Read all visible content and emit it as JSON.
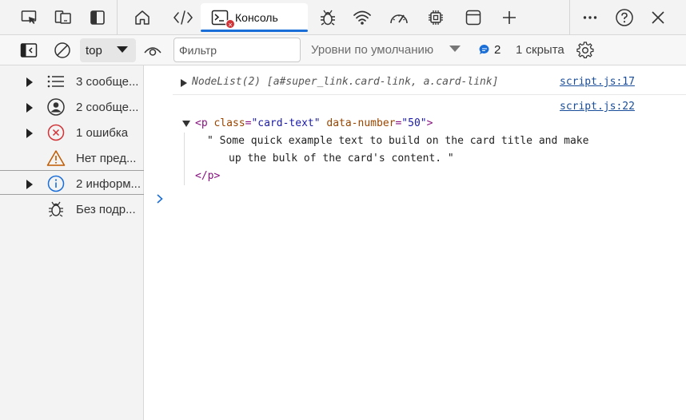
{
  "tabbar": {
    "console_tab_label": "Консоль",
    "console_error_badge": "×"
  },
  "toolbar": {
    "context": "top",
    "filter_placeholder": "Фильтр",
    "levels": "Уровни по умолчанию",
    "issues_count": "2",
    "hidden_label": "1 скрыта"
  },
  "sidebar": {
    "items": [
      {
        "label": "3 сообще...",
        "icon": "list-icon"
      },
      {
        "label": "2 сообще...",
        "icon": "user-icon"
      },
      {
        "label": "1 ошибка",
        "icon": "error-icon"
      },
      {
        "label": "Нет пред...",
        "icon": "warning-icon"
      },
      {
        "label": "2 информ...",
        "icon": "info-icon"
      },
      {
        "label": "Без подр...",
        "icon": "bug-icon"
      }
    ]
  },
  "console": {
    "entry1": {
      "text": "NodeList(2) [a#super_link.card-link, a.card-link]",
      "source": "script.js:17"
    },
    "entry2": {
      "source": "script.js:22",
      "open_tag_start": "<p",
      "attr1_name": "class",
      "attr1_value": "\"card-text\"",
      "attr2_name": "data-number",
      "attr2_value": "\"50\"",
      "open_tag_end": ">",
      "text_line1": "\" Some quick example text to build on the card title and make",
      "text_line2": "up the bulk of the card's content. \"",
      "close_tag": "</p>"
    }
  },
  "colors": {
    "accent": "#1a6ed8",
    "error": "#d13438",
    "warning": "#c05a00",
    "info": "#1a6ed8",
    "link": "#1a4d99"
  }
}
